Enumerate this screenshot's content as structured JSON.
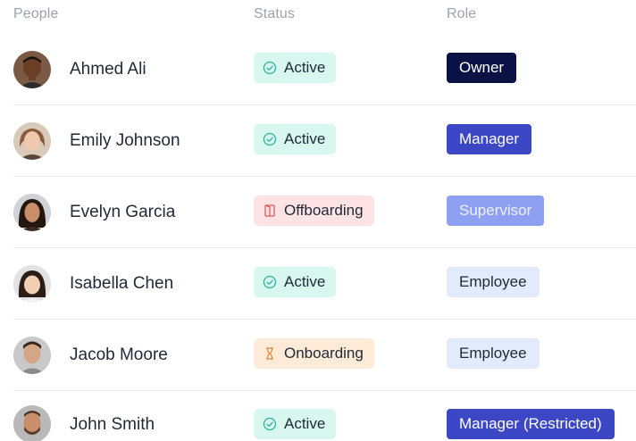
{
  "header": {
    "people": "People",
    "status": "Status",
    "role": "Role"
  },
  "rows": [
    {
      "name": "Ahmed Ali",
      "status": "Active",
      "status_type": "active",
      "role": "Owner",
      "role_type": "owner"
    },
    {
      "name": "Emily Johnson",
      "status": "Active",
      "status_type": "active",
      "role": "Manager",
      "role_type": "manager"
    },
    {
      "name": "Evelyn Garcia",
      "status": "Offboarding",
      "status_type": "offboarding",
      "role": "Supervisor",
      "role_type": "supervisor"
    },
    {
      "name": "Isabella Chen",
      "status": "Active",
      "status_type": "active",
      "role": "Employee",
      "role_type": "employee"
    },
    {
      "name": "Jacob Moore",
      "status": "Onboarding",
      "status_type": "onboarding",
      "role": "Employee",
      "role_type": "employee"
    },
    {
      "name": "John Smith",
      "status": "Active",
      "status_type": "active",
      "role": "Manager (Restricted)",
      "role_type": "manager"
    }
  ],
  "icons": {
    "active": "check-circle-icon",
    "offboarding": "door-exit-icon",
    "onboarding": "hourglass-icon"
  },
  "colors": {
    "owner": "#0a1245",
    "manager": "#3b47c4",
    "supervisor": "#8ea0f2",
    "employee": "#e1ebfb",
    "active_bg": "#d7f7ef",
    "active_icon": "#2bb59a",
    "offboarding_bg": "#fde3e3",
    "offboarding_icon": "#e05a5a",
    "onboarding_bg": "#fdebd8",
    "onboarding_icon": "#e08a3c"
  }
}
